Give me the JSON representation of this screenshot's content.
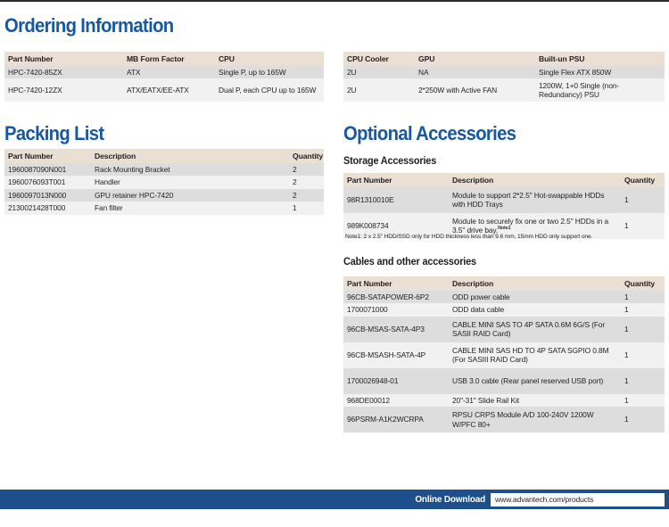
{
  "sections": {
    "ordering": {
      "title": "Ordering Information",
      "left_headers": [
        "Part Number",
        "MB Form Factor",
        "CPU"
      ],
      "right_headers": [
        "CPU Cooler",
        "GPU",
        "Built-un PSU"
      ],
      "left_rows": [
        [
          "HPC-7420-85ZX",
          "ATX",
          "Single P, up to 165W"
        ],
        [
          "HPC-7420-12ZX",
          "ATX/EATX/EE-ATX",
          "Dual P, each CPU up to 165W"
        ]
      ],
      "right_rows": [
        [
          "2U",
          "NA",
          "Single Flex ATX 850W"
        ],
        [
          "2U",
          "2*250W with Active FAN",
          "1200W, 1+0 Single (non-Redundancy) PSU"
        ]
      ]
    },
    "packing": {
      "title": "Packing List",
      "headers": [
        "Part Number",
        "Description",
        "Quantity"
      ],
      "rows": [
        [
          "1960087090N001",
          "Rack Mounting Bracket",
          "2"
        ],
        [
          "1960076093T001",
          "Handler",
          "2"
        ],
        [
          "1960097013N000",
          "GPU retainer HPC-7420",
          "2"
        ],
        [
          "2130021428T000",
          "Fan filter",
          "1"
        ]
      ]
    },
    "optional": {
      "title": "Optional Accessories",
      "storage": {
        "subtitle": "Storage Accessories",
        "headers": [
          "Part Number",
          "Description",
          "Quantity"
        ],
        "rows": [
          [
            "98R1310010E",
            "Module to support 2*2.5\" Hot-swappable HDDs with HDD Trays",
            "",
            "1"
          ],
          [
            "989K008734",
            "Module to securely fix one or two 2.5\" HDDs in a 3.5\" drive bay.",
            "Note1",
            "1"
          ]
        ],
        "footnote": "Note1: 2 x 2.5\" HDD/SSD only for HDD thickness less than 9.6 mm, 15mm HDD only support one."
      },
      "cables": {
        "subtitle": "Cables and other accessories",
        "headers": [
          "Part Number",
          "Description",
          "Quantity"
        ],
        "rows": [
          [
            "96CB-SATAPOWER-6P2",
            "ODD power cable",
            "1"
          ],
          [
            "1700071000",
            "ODD data cable",
            "1"
          ],
          [
            "96CB-MSAS-SATA-4P3",
            "CABLE MINI SAS TO 4P SATA 0.6M 6G/S (For SASII RAID Card)",
            "1"
          ],
          [
            "96CB-MSASH-SATA-4P",
            "CABLE MINI SAS HD TO 4P SATA SGPIO 0.8M (For SASIII RAID Card)",
            "1"
          ],
          [
            "1700026948-01",
            "USB 3.0 cable (Rear panel reserved USB port)",
            "1"
          ],
          [
            "968DE00012",
            "20\"-31\" Slide Rail Kit",
            "1"
          ],
          [
            "96PSRM-A1K2WCRPA",
            "RPSU CRPS Module A/D 100-240V 1200W W/PFC 80+",
            "1"
          ]
        ]
      }
    }
  },
  "footer": {
    "label": "Online Download",
    "url": "www.advantech.com/products"
  },
  "colors": {
    "heading_blue": "#17589e",
    "footer_blue": "#1c4f8b",
    "table_header_beige": "#eadfd3",
    "row_dark": "#dddddd",
    "row_light": "#f1f1f1"
  }
}
